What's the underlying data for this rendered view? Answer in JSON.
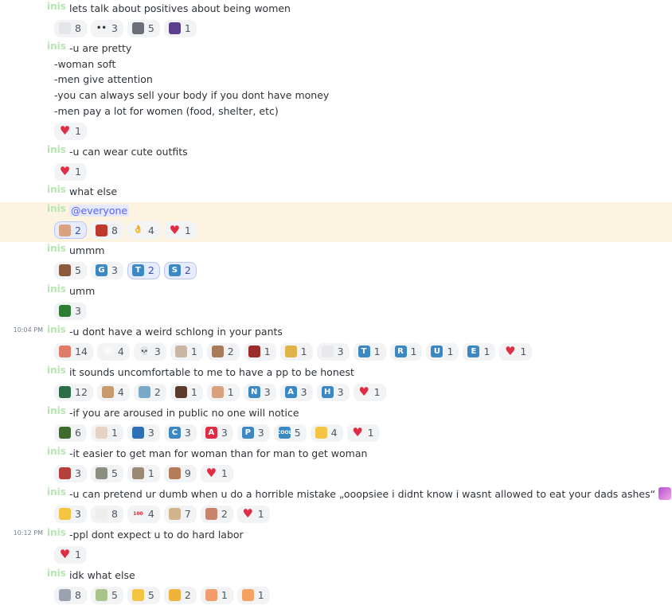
{
  "messages": [
    {
      "id": "m1",
      "author": "inis",
      "time": "",
      "lines": [
        "lets talk about positives about being women"
      ],
      "reactions": [
        {
          "icon": "wind-icon",
          "glyph": "",
          "color": "#e3e5e8",
          "count": "8"
        },
        {
          "icon": "eyes-icon",
          "glyph": "••",
          "color": "#f2f3f5",
          "textcolor": "#333",
          "count": "3"
        },
        {
          "icon": "cow-icon",
          "glyph": "",
          "color": "#6d6f78",
          "count": "5"
        },
        {
          "icon": "galaxy-icon",
          "glyph": "",
          "color": "#5b3f8f",
          "count": "1"
        }
      ]
    },
    {
      "id": "m2",
      "author": "inis",
      "time": "",
      "lines": [
        "-u are pretty",
        "-woman soft",
        "-men give attention",
        "-you can always sell your body if you dont have money",
        "-men pay a lot for women (food, shelter, etc)"
      ],
      "reactions": [
        {
          "icon": "heart-icon",
          "glyph": "♥",
          "color": "transparent",
          "textcolor": "#dd2e44",
          "count": "1"
        }
      ]
    },
    {
      "id": "m3",
      "author": "inis",
      "time": "",
      "lines": [
        "-u can wear cute outfits"
      ],
      "reactions": [
        {
          "icon": "heart-icon",
          "glyph": "♥",
          "color": "transparent",
          "textcolor": "#dd2e44",
          "count": "1"
        }
      ]
    },
    {
      "id": "m4",
      "author": "inis",
      "time": "",
      "lines": [
        "what else"
      ],
      "reactions": []
    },
    {
      "id": "m5",
      "author": "inis",
      "time": "",
      "mention": "@everyone",
      "highlight": true,
      "lines": [],
      "reactions": [
        {
          "icon": "face-sticker-icon",
          "glyph": "",
          "color": "#d9a27f",
          "count": "2",
          "me": true
        },
        {
          "icon": "angry-sticker-icon",
          "glyph": "",
          "color": "#c0392b",
          "count": "8"
        },
        {
          "icon": "ok-hand-icon",
          "glyph": "👌",
          "color": "transparent",
          "count": "4"
        },
        {
          "icon": "heart-icon",
          "glyph": "♥",
          "color": "transparent",
          "textcolor": "#dd2e44",
          "count": "1"
        }
      ]
    },
    {
      "id": "m6",
      "author": "inis",
      "time": "",
      "lines": [
        "ummm"
      ],
      "reactions": [
        {
          "icon": "person-sticker-icon",
          "glyph": "",
          "color": "#8b5a3c",
          "count": "5"
        },
        {
          "icon": "letter-g-icon",
          "glyph": "G",
          "color": "#3b88c3",
          "count": "3"
        },
        {
          "icon": "letter-t-icon",
          "glyph": "T",
          "color": "#3b88c3",
          "count": "2",
          "me": true
        },
        {
          "icon": "letter-s-icon",
          "glyph": "S",
          "color": "#3b88c3",
          "count": "2",
          "me": true
        }
      ]
    },
    {
      "id": "m7",
      "author": "inis",
      "time": "",
      "lines": [
        "umm"
      ],
      "reactions": [
        {
          "icon": "frog-sticker-icon",
          "glyph": "",
          "color": "#2e7d32",
          "count": "3"
        }
      ]
    },
    {
      "id": "m8",
      "author": "inis",
      "time": "10:04 PM",
      "lines": [
        "-u dont have a weird schlong in your pants"
      ],
      "reactions": [
        {
          "icon": "peach-sticker-icon",
          "glyph": "",
          "color": "#e07b6a",
          "count": "14"
        },
        {
          "icon": "joy-icon",
          "glyph": "😂",
          "color": "transparent",
          "count": "4"
        },
        {
          "icon": "skull-icon",
          "glyph": "💀",
          "color": "transparent",
          "count": "3"
        },
        {
          "icon": "clown-sticker-icon",
          "glyph": "",
          "color": "#c9b6a5",
          "count": "1"
        },
        {
          "icon": "face-sticker-icon",
          "glyph": "",
          "color": "#a87c5a",
          "count": "2"
        },
        {
          "icon": "bag-sticker-icon",
          "glyph": "",
          "color": "#9c2b2b",
          "count": "1"
        },
        {
          "icon": "crown-sticker-icon",
          "glyph": "",
          "color": "#e0b34a",
          "count": "1"
        },
        {
          "icon": "snow-sticker-icon",
          "glyph": "",
          "color": "#e8e8ee",
          "count": "3"
        },
        {
          "icon": "letter-t-icon",
          "glyph": "T",
          "color": "#3b88c3",
          "count": "1"
        },
        {
          "icon": "letter-r-icon",
          "glyph": "R",
          "color": "#3b88c3",
          "count": "1"
        },
        {
          "icon": "letter-u-icon",
          "glyph": "U",
          "color": "#3b88c3",
          "count": "1"
        },
        {
          "icon": "letter-e-icon",
          "glyph": "E",
          "color": "#3b88c3",
          "count": "1"
        },
        {
          "icon": "heart-icon",
          "glyph": "♥",
          "color": "transparent",
          "textcolor": "#dd2e44",
          "count": "1"
        }
      ]
    },
    {
      "id": "m9",
      "author": "inis",
      "time": "",
      "lines": [
        "it sounds uncomfortable to me to have a pp to be honest"
      ],
      "reactions": [
        {
          "icon": "train-sticker-icon",
          "glyph": "",
          "color": "#2c6e49",
          "count": "12"
        },
        {
          "icon": "face-sticker-icon",
          "glyph": "",
          "color": "#c99a6e",
          "count": "4"
        },
        {
          "icon": "scene-sticker-icon",
          "glyph": "",
          "color": "#7aa8c7",
          "count": "2"
        },
        {
          "icon": "person-sticker-icon",
          "glyph": "",
          "color": "#5a3a2a",
          "count": "1"
        },
        {
          "icon": "face-sticker-icon",
          "glyph": "",
          "color": "#d9a27f",
          "count": "1"
        },
        {
          "icon": "letter-n-icon",
          "glyph": "N",
          "color": "#3b88c3",
          "count": "3"
        },
        {
          "icon": "letter-a-icon",
          "glyph": "A",
          "color": "#3b88c3",
          "count": "3"
        },
        {
          "icon": "letter-h-icon",
          "glyph": "H",
          "color": "#3b88c3",
          "count": "3"
        },
        {
          "icon": "heart-icon",
          "glyph": "♥",
          "color": "transparent",
          "textcolor": "#dd2e44",
          "count": "1"
        }
      ]
    },
    {
      "id": "m10",
      "author": "inis",
      "time": "",
      "lines": [
        "-if you are aroused in public no one will notice"
      ],
      "reactions": [
        {
          "icon": "hat-sticker-icon",
          "glyph": "",
          "color": "#3f6b2e",
          "count": "6"
        },
        {
          "icon": "book-sticker-icon",
          "glyph": "",
          "color": "#e6d3c3",
          "count": "1"
        },
        {
          "icon": "cap-icon",
          "glyph": "",
          "color": "#2f6fb5",
          "count": "3"
        },
        {
          "icon": "letter-c-icon",
          "glyph": "C",
          "color": "#3b88c3",
          "count": "3"
        },
        {
          "icon": "letter-a-red-icon",
          "glyph": "A",
          "color": "#dd2e44",
          "count": "3"
        },
        {
          "icon": "letter-p-icon",
          "glyph": "P",
          "color": "#3b88c3",
          "count": "3"
        },
        {
          "icon": "cool-icon",
          "glyph": "COOL",
          "color": "#3b88c3",
          "count": "5",
          "small": true
        },
        {
          "icon": "relieved-icon",
          "glyph": "",
          "color": "#f4c542",
          "count": "4"
        },
        {
          "icon": "heart-icon",
          "glyph": "♥",
          "color": "transparent",
          "textcolor": "#dd2e44",
          "count": "1"
        }
      ]
    },
    {
      "id": "m11",
      "author": "inis",
      "time": "",
      "lines": [
        "-it easier to get man for woman than for man to get woman"
      ],
      "reactions": [
        {
          "icon": "girl-sticker-icon",
          "glyph": "",
          "color": "#b5403a",
          "count": "3"
        },
        {
          "icon": "alien-sticker-icon",
          "glyph": "",
          "color": "#8a8f80",
          "count": "5"
        },
        {
          "icon": "cat-sticker-icon",
          "glyph": "",
          "color": "#9b8a75",
          "count": "1"
        },
        {
          "icon": "face-sticker-icon",
          "glyph": "",
          "color": "#b57c5a",
          "count": "9"
        },
        {
          "icon": "heart-icon",
          "glyph": "♥",
          "color": "transparent",
          "textcolor": "#dd2e44",
          "count": "1"
        }
      ]
    },
    {
      "id": "m12",
      "author": "inis",
      "time": "",
      "lines": [
        "-u can pretend ur dumb when u do a horrible mistake „ooopsiee i didnt know i wasnt allowed to eat your dads ashes“"
      ],
      "tailimage": true,
      "reactions": [
        {
          "icon": "smirk-icon",
          "glyph": "",
          "color": "#f4c542",
          "count": "3"
        },
        {
          "icon": "face-outline-icon",
          "glyph": "",
          "color": "#eeeeee",
          "count": "8"
        },
        {
          "icon": "hundred-icon",
          "glyph": "100",
          "color": "transparent",
          "textcolor": "#dd2e44",
          "count": "4",
          "small": true
        },
        {
          "icon": "cow-sticker-icon",
          "glyph": "",
          "color": "#d3b38c",
          "count": "7"
        },
        {
          "icon": "face-sticker-icon",
          "glyph": "",
          "color": "#c9836a",
          "count": "2"
        },
        {
          "icon": "heart-icon",
          "glyph": "♥",
          "color": "transparent",
          "textcolor": "#dd2e44",
          "count": "1"
        }
      ]
    },
    {
      "id": "m13",
      "author": "inis",
      "time": "10:12 PM",
      "lines": [
        "-ppl dont expect u to do hard labor"
      ],
      "reactions": [
        {
          "icon": "heart-icon",
          "glyph": "♥",
          "color": "transparent",
          "textcolor": "#dd2e44",
          "count": "1"
        }
      ]
    },
    {
      "id": "m14",
      "author": "inis",
      "time": "",
      "lines": [
        "idk what else"
      ],
      "reactions": [
        {
          "icon": "moai-sticker-icon",
          "glyph": "",
          "color": "#9aa3ad",
          "count": "8"
        },
        {
          "icon": "hands-sticker-icon",
          "glyph": "",
          "color": "#a9c48a",
          "count": "5"
        },
        {
          "icon": "thinking-icon",
          "glyph": "",
          "color": "#f4c542",
          "count": "5"
        },
        {
          "icon": "woman-shrug-icon",
          "glyph": "",
          "color": "#f0b23a",
          "count": "2"
        },
        {
          "icon": "peach-icon",
          "glyph": "",
          "color": "#f49b6b",
          "count": "1"
        },
        {
          "icon": "person-raising-icon",
          "glyph": "",
          "color": "#f4a261",
          "count": "1"
        }
      ]
    }
  ]
}
